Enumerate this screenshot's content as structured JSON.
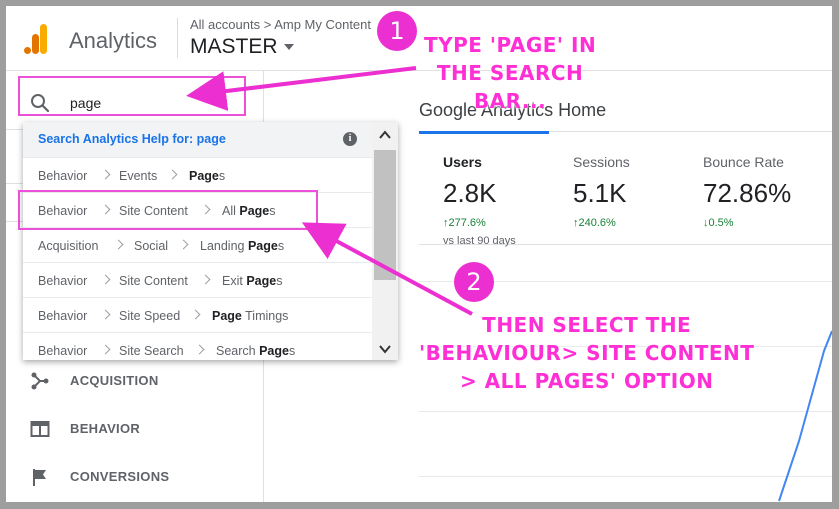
{
  "header": {
    "app_name": "Analytics",
    "breadcrumb": "All accounts > Amp My Content",
    "account_name": "MASTER"
  },
  "search": {
    "value": "page",
    "placeholder": ""
  },
  "dropdown": {
    "help_text": "Search Analytics Help for: page",
    "info_icon": "i",
    "rows": [
      {
        "parts": [
          "Behavior",
          "Events"
        ],
        "leaf_bold": "Page",
        "leaf_rest": "s"
      },
      {
        "parts": [
          "Behavior",
          "Site Content"
        ],
        "leaf_pre": "All ",
        "leaf_bold": "Page",
        "leaf_rest": "s"
      },
      {
        "parts": [
          "Acquisition",
          "Social"
        ],
        "leaf_pre": "Landing ",
        "leaf_bold": "Page",
        "leaf_rest": "s"
      },
      {
        "parts": [
          "Behavior",
          "Site Content"
        ],
        "leaf_pre": "Exit ",
        "leaf_bold": "Page",
        "leaf_rest": "s"
      },
      {
        "parts": [
          "Behavior",
          "Site Speed"
        ],
        "leaf_bold": "Page",
        "leaf_rest": " Timings"
      },
      {
        "parts": [
          "Behavior",
          "Site Search"
        ],
        "leaf_pre": "Search ",
        "leaf_bold": "Page",
        "leaf_rest": "s"
      }
    ]
  },
  "nav": [
    {
      "label": "ACQUISITION",
      "icon": "acquisition-icon"
    },
    {
      "label": "BEHAVIOR",
      "icon": "behavior-icon"
    },
    {
      "label": "CONVERSIONS",
      "icon": "flag-icon"
    }
  ],
  "main": {
    "title": "Google Analytics Home",
    "kpis": [
      {
        "label": "Users",
        "value": "2.8K",
        "change": "277.6%",
        "direction": "up",
        "sub": "vs last 90 days"
      },
      {
        "label": "Sessions",
        "value": "5.1K",
        "change": "240.6%",
        "direction": "up"
      },
      {
        "label": "Bounce Rate",
        "value": "72.86%",
        "change": "0.5%",
        "direction": "down"
      }
    ]
  },
  "annotations": {
    "step1_number": "1",
    "step1_lines": [
      "TYPE 'PAGE' IN",
      "THE SEARCH",
      "BAR..."
    ],
    "step2_number": "2",
    "step2_lines": [
      "THEN SELECT THE",
      "'BEHAVIOUR> SITE CONTENT",
      "> ALL PAGES' OPTION"
    ]
  },
  "colors": {
    "accent": "#1a73e8",
    "annotation_pink": "#ec2fd0",
    "positive": "#188038"
  }
}
